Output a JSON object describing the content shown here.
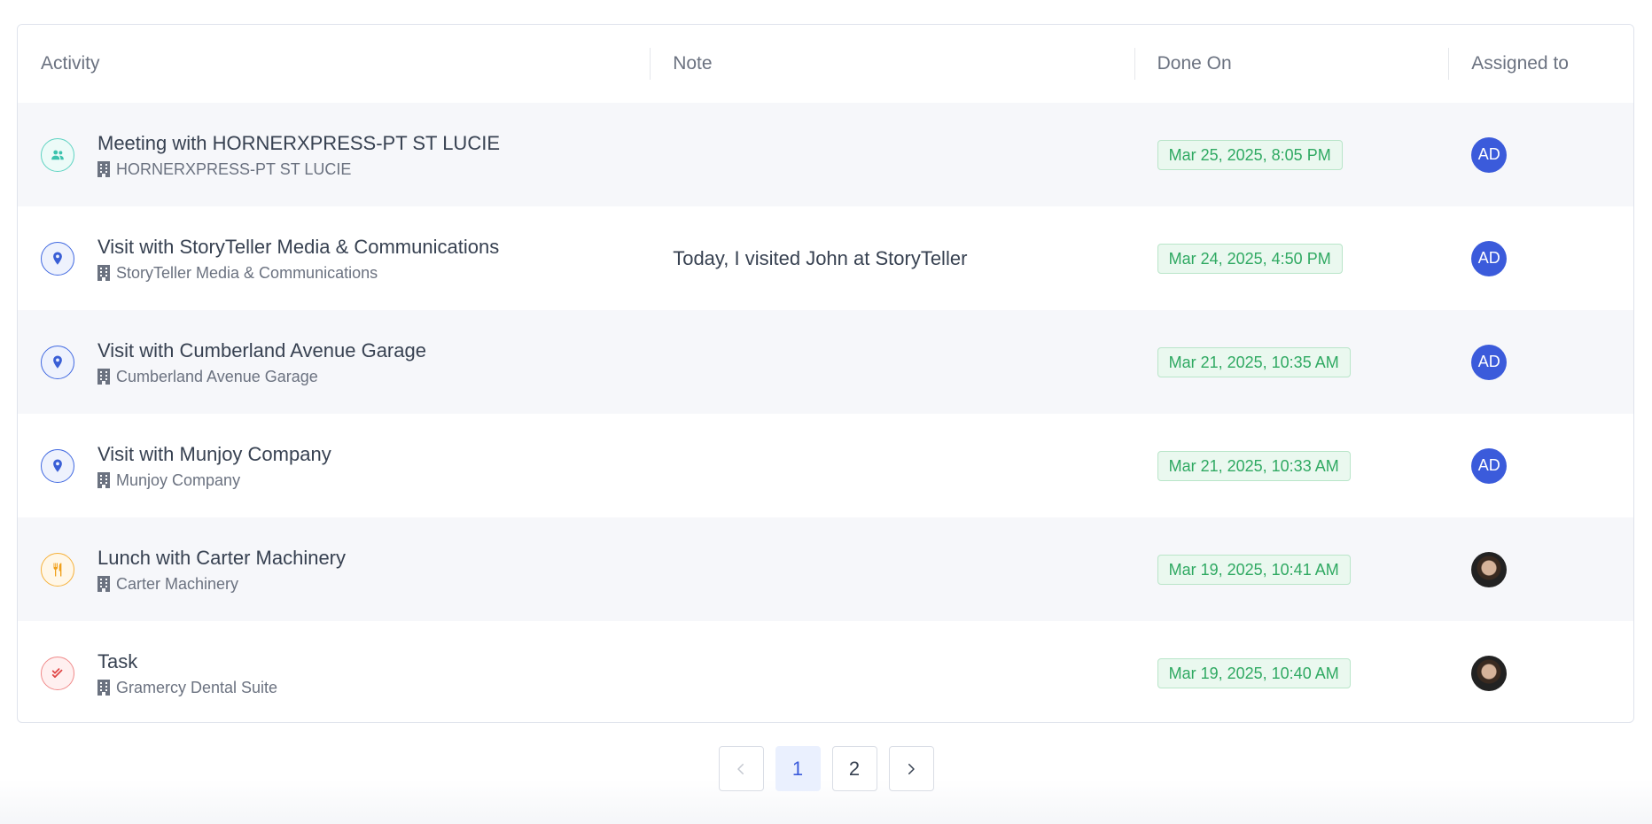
{
  "table": {
    "headers": {
      "activity": "Activity",
      "note": "Note",
      "done_on": "Done On",
      "assigned_to": "Assigned to"
    },
    "rows": [
      {
        "icon": "meeting-icon",
        "title": "Meeting with HORNERXPRESS-PT ST LUCIE",
        "company": "HORNERXPRESS-PT ST LUCIE",
        "note": "",
        "done_on": "Mar 25, 2025, 8:05 PM",
        "assignee_initials": "AD"
      },
      {
        "icon": "visit-pin-icon",
        "title": "Visit with StoryTeller Media & Communications",
        "company": "StoryTeller Media & Communications",
        "note": "Today, I visited John at StoryTeller",
        "done_on": "Mar 24, 2025, 4:50 PM",
        "assignee_initials": "AD"
      },
      {
        "icon": "visit-pin-icon",
        "title": "Visit with Cumberland Avenue Garage",
        "company": "Cumberland Avenue Garage",
        "note": "",
        "done_on": "Mar 21, 2025, 10:35 AM",
        "assignee_initials": "AD"
      },
      {
        "icon": "visit-pin-icon",
        "title": "Visit with Munjoy Company",
        "company": "Munjoy Company",
        "note": "",
        "done_on": "Mar 21, 2025, 10:33 AM",
        "assignee_initials": "AD"
      },
      {
        "icon": "lunch-icon",
        "title": "Lunch with Carter Machinery",
        "company": "Carter Machinery",
        "note": "",
        "done_on": "Mar 19, 2025, 10:41 AM",
        "assignee_initials": ""
      },
      {
        "icon": "task-icon",
        "title": "Task",
        "company": "Gramercy Dental Suite",
        "note": "",
        "done_on": "Mar 19, 2025, 10:40 AM",
        "assignee_initials": ""
      }
    ]
  },
  "pagination": {
    "pages": [
      "1",
      "2"
    ],
    "current": "1"
  },
  "colors": {
    "accent": "#3b5bdb",
    "badge_text": "#2fa962",
    "badge_bg": "#eaf8ef"
  }
}
